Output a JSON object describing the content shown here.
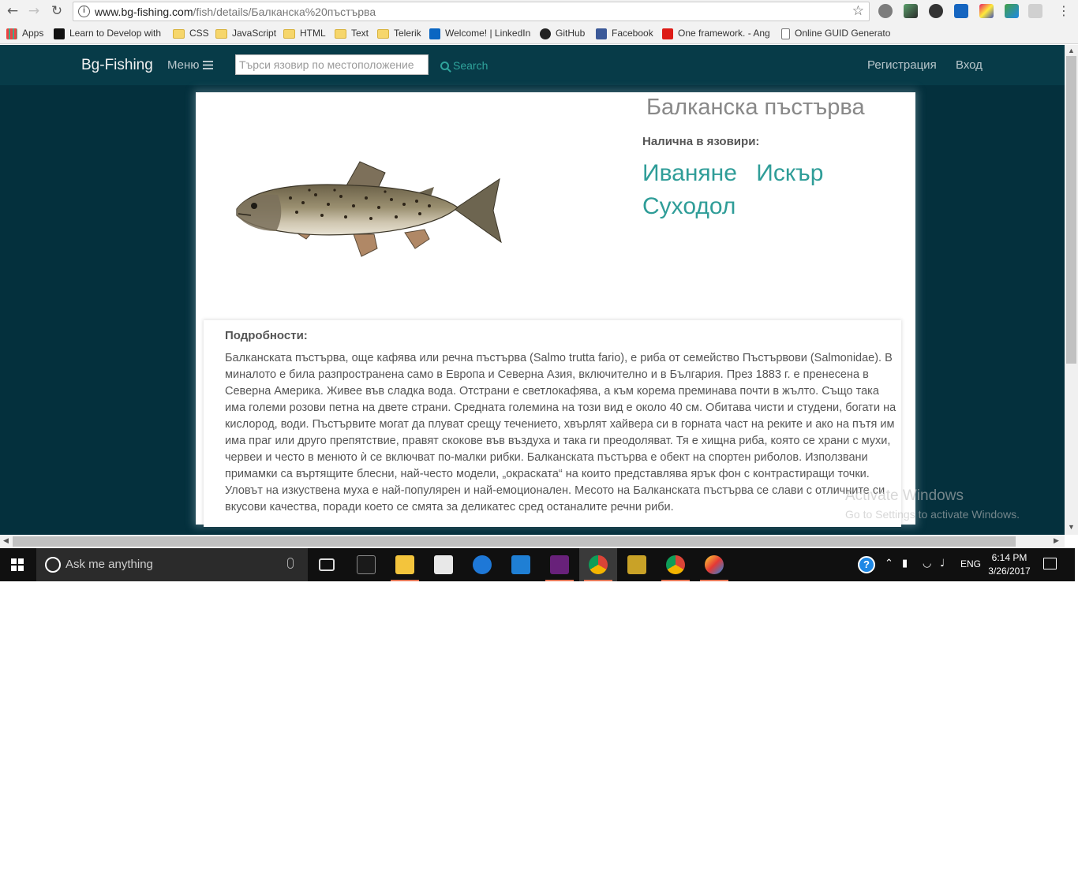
{
  "browser": {
    "url_host": "www.bg-fishing.com",
    "url_path": "/fish/details/Балканска%20пъстърва",
    "bookmarks": [
      {
        "label": "Apps",
        "icon": "apps-grid-icon"
      },
      {
        "label": "Learn to Develop with",
        "icon": "m-logo-icon"
      },
      {
        "label": "CSS",
        "icon": "folder-icon"
      },
      {
        "label": "JavaScript",
        "icon": "folder-icon"
      },
      {
        "label": "HTML",
        "icon": "folder-icon"
      },
      {
        "label": "Text",
        "icon": "folder-icon"
      },
      {
        "label": "Telerik",
        "icon": "folder-icon"
      },
      {
        "label": "Welcome! | LinkedIn",
        "icon": "linkedin-icon"
      },
      {
        "label": "GitHub",
        "icon": "github-icon"
      },
      {
        "label": "Facebook",
        "icon": "facebook-icon"
      },
      {
        "label": "One framework. - Ang",
        "icon": "angular-icon"
      },
      {
        "label": "Online GUID Generato",
        "icon": "page-icon"
      }
    ]
  },
  "navbar": {
    "brand": "Bg-Fishing",
    "menu_label": "Меню",
    "search_placeholder": "Търси язовир по местоположение",
    "search_label": "Search",
    "register_label": "Регистрация",
    "login_label": "Вход"
  },
  "fish": {
    "title": "Балканска пъстърва",
    "lakes_label": "Налична в язовири:",
    "lakes": [
      "Иваняне",
      "Искър",
      "Суходол"
    ],
    "details_label": "Подробности:",
    "details_text": "Балканската пъстърва, още кафява или речна пъстърва (Salmo trutta fario), е риба от семейство Пъстървови (Salmonidae). В миналото е била разпространена само в Европа и Северна Азия, включително и в България. През 1883 г. е пренесена в Северна Америка. Живее във сладка вода. Отстрани е светлокафява, а към корема преминава почти в жълто. Също така има големи розови петна на двете страни. Средната големина на този вид е около 40 см. Обитава чисти и студени, богати на кислород, води. Пъстървите могат да плуват срещу течението, хвърлят хайвера си в горната част на реките и ако на пътя им има праг или друго препятствие, правят скокове във въздуха и така ги преодоляват. Тя е хищна риба, която се храни с мухи, червеи и често в менюто ѝ се включват по-малки рибки. Балканската пъстърва е обект на спортен риболов. Използвани примамки са въртящите блесни, най-често модели, „окраската“ на които представлява ярък фон с контрастиращи точки. Уловът на изкуствена муха е най-популярен и най-емоционален. Месото на Балканската пъстърва се слави с отличните си вкусови качества, поради което се смята за деликатес сред останалите речни риби."
  },
  "watermark": {
    "line1": "Activate Windows",
    "line2": "Go to Settings to activate Windows."
  },
  "taskbar": {
    "search_placeholder": "Ask me anything",
    "language": "ENG",
    "time": "6:14 PM",
    "date": "3/26/2017"
  },
  "colors": {
    "page_bg": "#04303d",
    "navbar_bg": "#073b48",
    "accent": "#2f9d98"
  }
}
